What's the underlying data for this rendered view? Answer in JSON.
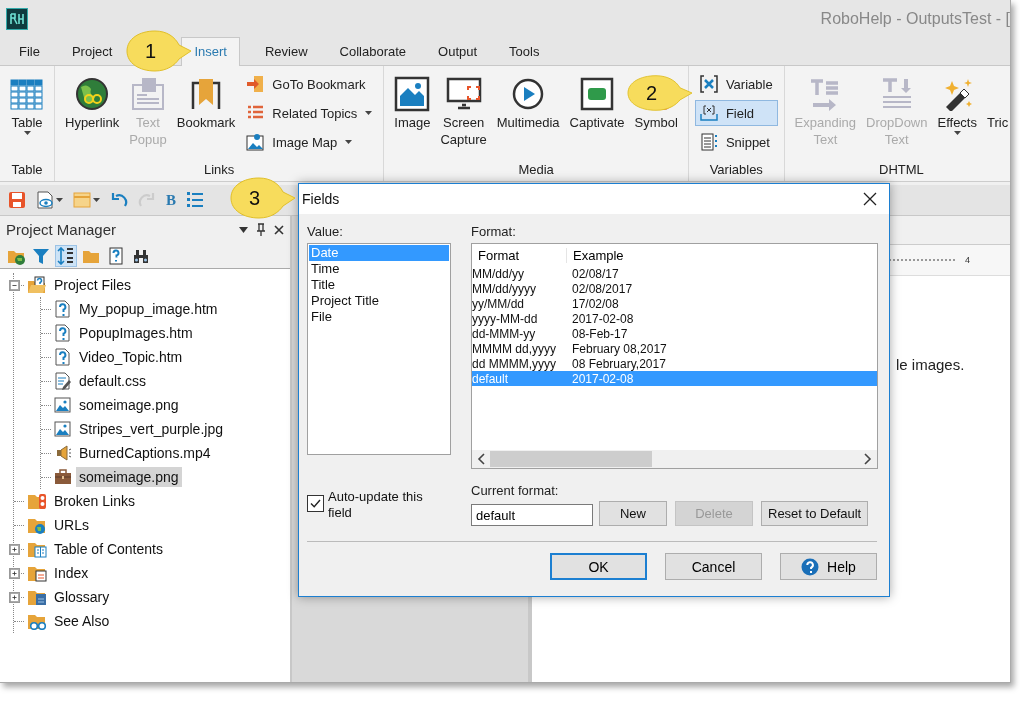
{
  "window": {
    "title": "RoboHelp - OutputsTest - ["
  },
  "tabs": [
    {
      "label": "File",
      "selected": false
    },
    {
      "label": "Project",
      "selected": false
    },
    {
      "label": "Insert",
      "selected": true
    },
    {
      "label": "Review",
      "selected": false
    },
    {
      "label": "Collaborate",
      "selected": false
    },
    {
      "label": "Output",
      "selected": false
    },
    {
      "label": "Tools",
      "selected": false
    }
  ],
  "ribbon": {
    "groups": [
      {
        "label": "Table",
        "items": [
          {
            "kind": "large",
            "label": "Table",
            "disabled": false,
            "selected": false,
            "dropdown": true
          }
        ]
      },
      {
        "label": "Links",
        "items": [
          {
            "kind": "large",
            "label": "Hyperlink",
            "disabled": false,
            "selected": false,
            "dropdown": false
          },
          {
            "kind": "large",
            "label": "Text Popup",
            "disabled": true,
            "selected": false,
            "dropdown": false
          },
          {
            "kind": "large",
            "label": "Bookmark",
            "disabled": false,
            "selected": false,
            "dropdown": false
          },
          {
            "kind": "small",
            "label": "GoTo Bookmark",
            "disabled": false,
            "selected": false,
            "dropdown": false
          },
          {
            "kind": "small",
            "label": "Related Topics",
            "disabled": false,
            "selected": false,
            "dropdown": true
          },
          {
            "kind": "small",
            "label": "Image Map",
            "disabled": false,
            "selected": false,
            "dropdown": true
          }
        ]
      },
      {
        "label": "Media",
        "items": [
          {
            "kind": "large",
            "label": "Image",
            "disabled": false,
            "selected": false,
            "dropdown": false
          },
          {
            "kind": "large",
            "label": "Screen Capture",
            "disabled": false,
            "selected": false,
            "dropdown": false
          },
          {
            "kind": "large",
            "label": "Multimedia",
            "disabled": false,
            "selected": false,
            "dropdown": false
          },
          {
            "kind": "large",
            "label": "Captivate",
            "disabled": false,
            "selected": false,
            "dropdown": false
          },
          {
            "kind": "large",
            "label": "Symbol",
            "disabled": false,
            "selected": false,
            "dropdown": false
          }
        ]
      },
      {
        "label": "Variables",
        "items": [
          {
            "kind": "small",
            "label": "Variable",
            "disabled": false,
            "selected": false,
            "dropdown": false
          },
          {
            "kind": "small",
            "label": "Field",
            "disabled": false,
            "selected": true,
            "dropdown": false
          },
          {
            "kind": "small",
            "label": "Snippet",
            "disabled": false,
            "selected": false,
            "dropdown": false
          }
        ]
      },
      {
        "label": "DHTML",
        "items": [
          {
            "kind": "large",
            "label": "Expanding Text",
            "disabled": true,
            "selected": false,
            "dropdown": false
          },
          {
            "kind": "large",
            "label": "DropDown Text",
            "disabled": true,
            "selected": false,
            "dropdown": false
          },
          {
            "kind": "large",
            "label": "Effects",
            "disabled": false,
            "selected": false,
            "dropdown": true
          },
          {
            "kind": "large",
            "label": "Tric",
            "disabled": false,
            "selected": false,
            "dropdown": false
          }
        ]
      }
    ]
  },
  "toolbar": {
    "buttons": [
      {
        "disabled": false,
        "dropdown": false
      },
      {
        "disabled": false,
        "dropdown": true
      },
      {
        "disabled": false,
        "dropdown": true
      },
      {
        "disabled": false,
        "dropdown": false
      },
      {
        "disabled": true,
        "dropdown": false
      },
      {
        "disabled": false,
        "dropdown": false,
        "label": "B"
      },
      {
        "disabled": false,
        "dropdown": false
      }
    ]
  },
  "project_manager": {
    "title": "Project Manager",
    "tools": [
      {
        "selected": false
      },
      {
        "selected": false
      },
      {
        "selected": true
      },
      {
        "selected": false
      },
      {
        "selected": false
      },
      {
        "selected": false
      }
    ],
    "tree": [
      {
        "label": "Project Files",
        "expanded": true,
        "selected": false,
        "children": [
          {
            "label": "My_popup_image.htm",
            "selected": false
          },
          {
            "label": "PopupImages.htm",
            "selected": false
          },
          {
            "label": "Video_Topic.htm",
            "selected": false
          },
          {
            "label": "default.css",
            "selected": false
          },
          {
            "label": "someimage.png",
            "selected": false
          },
          {
            "label": "Stripes_vert_purple.jpg",
            "selected": false
          },
          {
            "label": "BurnedCaptions.mp4",
            "selected": false
          },
          {
            "label": "someimage.png",
            "selected": true
          }
        ]
      },
      {
        "label": "Broken Links",
        "selected": false
      },
      {
        "label": "URLs",
        "selected": false
      },
      {
        "label": "Table of Contents",
        "expanded": false,
        "selected": false
      },
      {
        "label": "Index",
        "expanded": false,
        "selected": false
      },
      {
        "label": "Glossary",
        "expanded": false,
        "selected": false
      },
      {
        "label": "See Also",
        "selected": false
      }
    ]
  },
  "editor": {
    "ruler_label": "4",
    "text": "le images."
  },
  "dialog": {
    "title": "Fields",
    "value_label": "Value:",
    "values": [
      {
        "label": "Date",
        "selected": true
      },
      {
        "label": "Time",
        "selected": false
      },
      {
        "label": "Title",
        "selected": false
      },
      {
        "label": "Project Title",
        "selected": false
      },
      {
        "label": "File",
        "selected": false
      }
    ],
    "format_label": "Format:",
    "columns": [
      "Format",
      "Example"
    ],
    "rows": [
      {
        "format": "MM/dd/yy",
        "example": "02/08/17",
        "selected": false
      },
      {
        "format": "MM/dd/yyyy",
        "example": "02/08/2017",
        "selected": false
      },
      {
        "format": "yy/MM/dd",
        "example": "17/02/08",
        "selected": false
      },
      {
        "format": "yyyy-MM-dd",
        "example": "2017-02-08",
        "selected": false
      },
      {
        "format": "dd-MMM-yy",
        "example": "08-Feb-17",
        "selected": false
      },
      {
        "format": "MMMM dd,yyyy",
        "example": "February 08,2017",
        "selected": false
      },
      {
        "format": "dd MMMM,yyyy",
        "example": "08 February,2017",
        "selected": false
      },
      {
        "format": "default",
        "example": "2017-02-08",
        "selected": true
      }
    ],
    "auto_update": {
      "label": "Auto-update this field",
      "checked": true
    },
    "current_format_label": "Current format:",
    "current_format": "default",
    "buttons": [
      {
        "label": "New",
        "disabled": false
      },
      {
        "label": "Delete",
        "disabled": true
      },
      {
        "label": "Reset to Default",
        "disabled": false
      }
    ],
    "footer_buttons": [
      {
        "label": "OK",
        "default": true
      },
      {
        "label": "Cancel",
        "default": false
      },
      {
        "label": "Help",
        "default": false
      }
    ]
  },
  "callouts": [
    {
      "number": "1"
    },
    {
      "number": "2"
    },
    {
      "number": "3"
    }
  ]
}
